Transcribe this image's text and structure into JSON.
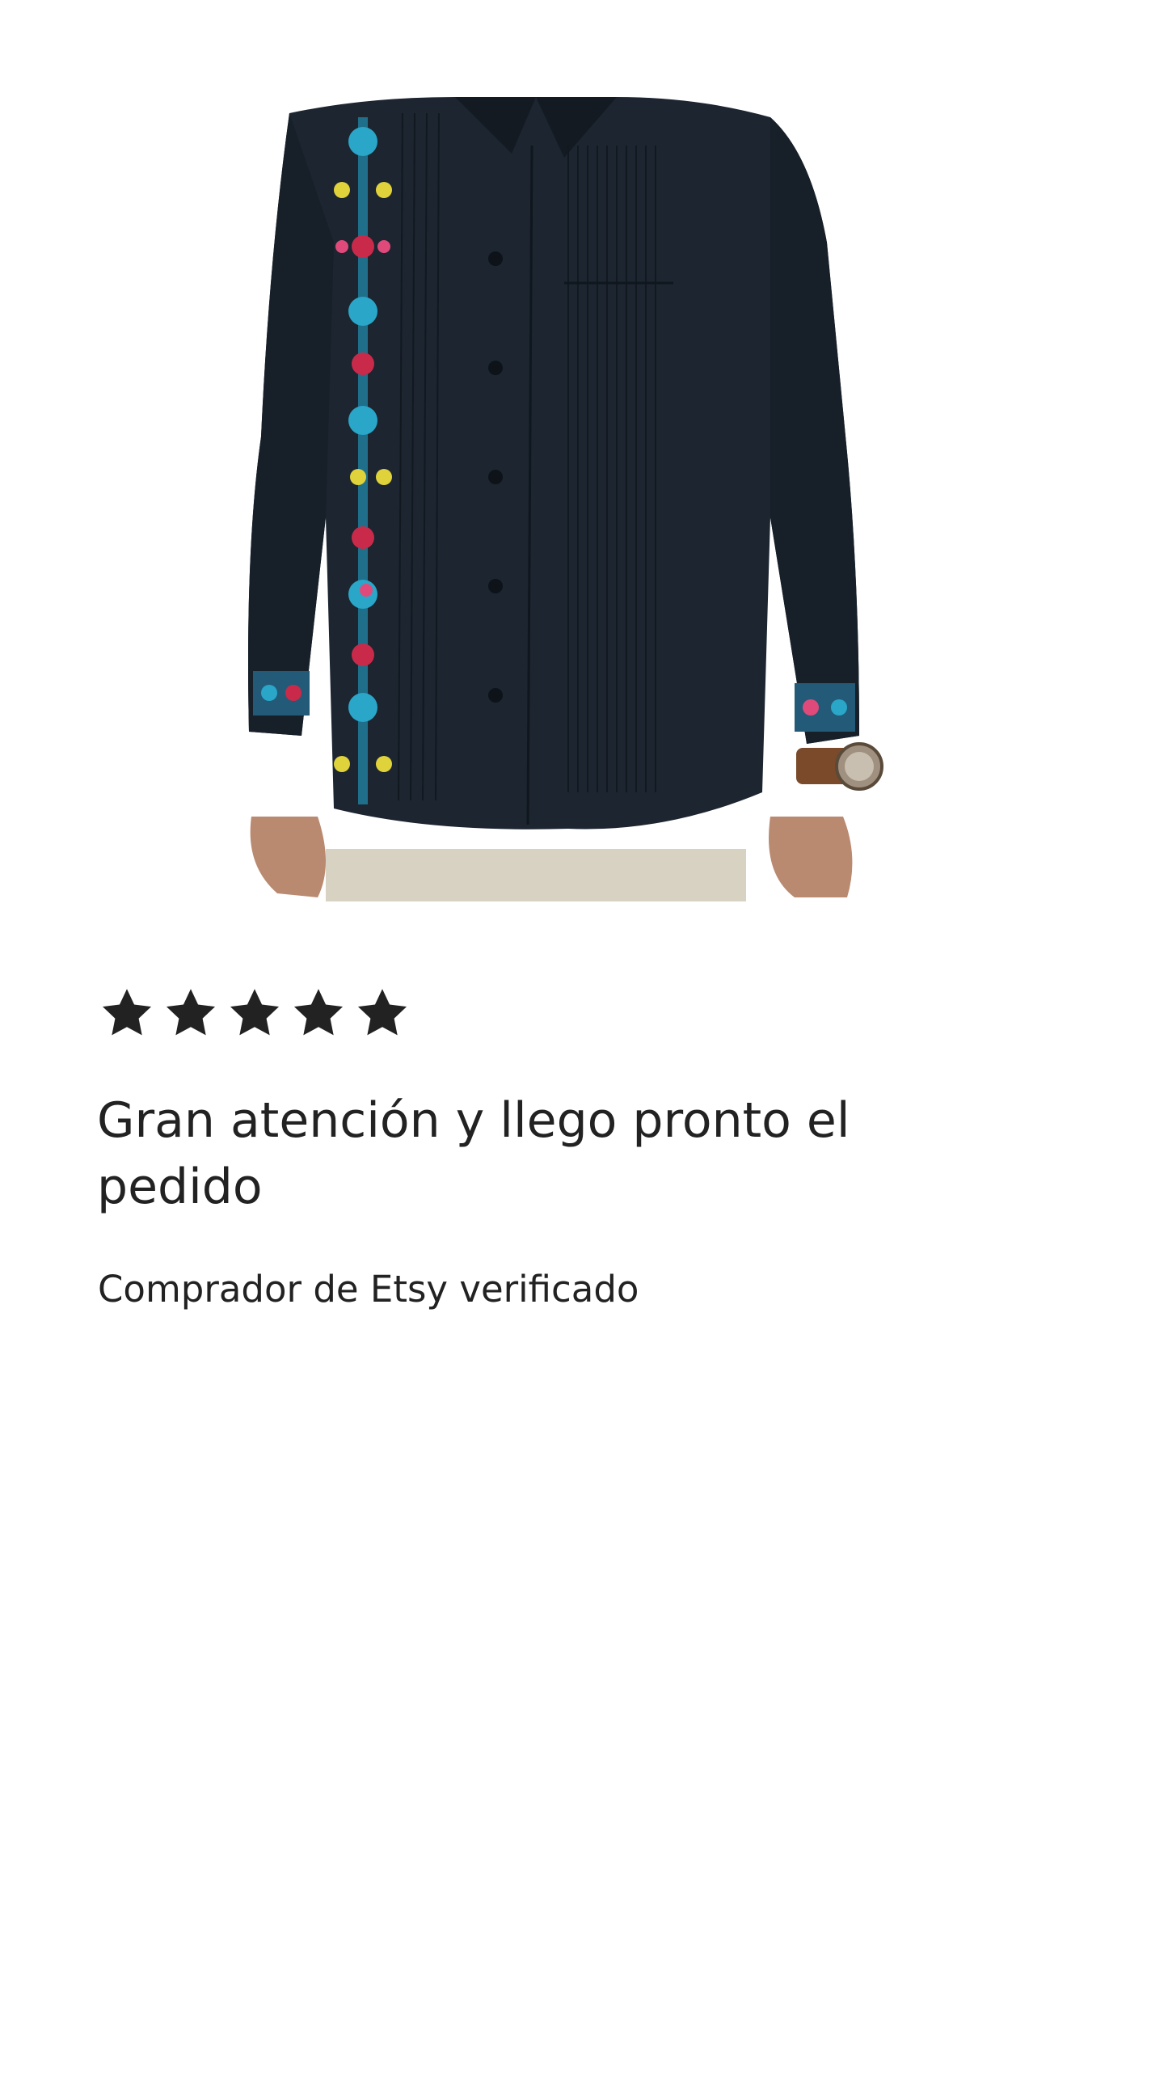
{
  "product_image": {
    "alt": "",
    "icon": "embroidered-guayabera-shirt-photo"
  },
  "review": {
    "rating": 5,
    "rating_max": 5,
    "star_color": "#222222",
    "title": "Gran atención y llego pronto el pedido",
    "reviewer": "Comprador de Etsy verificado"
  }
}
